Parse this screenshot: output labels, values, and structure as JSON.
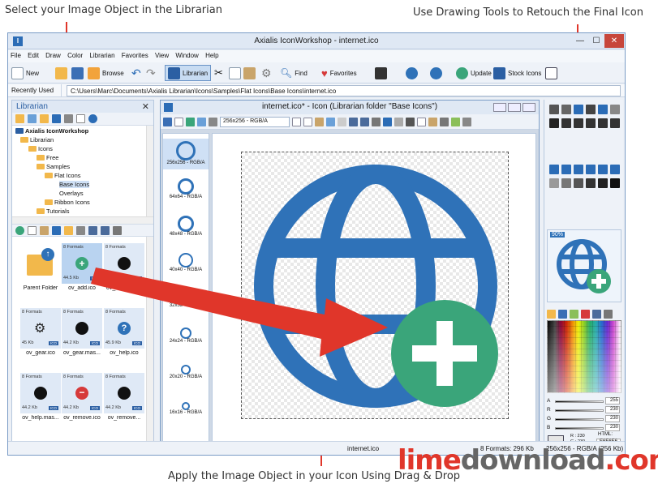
{
  "callouts": {
    "top_left": "Select your Image Object in the Librarian",
    "top_right": "Use Drawing Tools to Retouch the Final Icon",
    "bottom": "Apply the Image Object in your Icon Using Drag & Drop"
  },
  "window": {
    "title": "Axialis IconWorkshop - internet.ico",
    "minimize": "—",
    "maximize": "☐",
    "close": "✕"
  },
  "menu": [
    "File",
    "Edit",
    "Draw",
    "Color",
    "Librarian",
    "Favorites",
    "View",
    "Window",
    "Help"
  ],
  "toolbar": {
    "new": "New",
    "browse": "Browse",
    "librarian": "Librarian",
    "find": "Find",
    "favorites": "Favorites",
    "update": "Update",
    "stock_icons": "Stock Icons"
  },
  "pathbar": {
    "recent": "Recently Used",
    "path": "C:\\Users\\Marc\\Documents\\Axialis Librarian\\Icons\\Samples\\Flat Icons\\Base Icons\\internet.ico"
  },
  "librarian": {
    "title": "Librarian",
    "close": "✕",
    "tree": [
      {
        "label": "Axialis IconWorkshop",
        "bold": true
      },
      {
        "label": "Librarian"
      },
      {
        "label": "Icons"
      },
      {
        "label": "Free"
      },
      {
        "label": "Samples"
      },
      {
        "label": "Flat Icons"
      },
      {
        "label": "Base Icons"
      },
      {
        "label": "Overlays"
      },
      {
        "label": "Ribbon Icons"
      },
      {
        "label": "Tutorials"
      }
    ],
    "items": [
      {
        "name": "Parent Folder",
        "formats": "",
        "size": "",
        "badge": ""
      },
      {
        "name": "ov_add.ico",
        "formats": "8 Formats",
        "size": "44.5 Kb",
        "badge": "ICO"
      },
      {
        "name": "ov_add.mas...",
        "formats": "8 Formats",
        "size": "44.2 Kb",
        "badge": "ICO"
      },
      {
        "name": "ov_gear.ico",
        "formats": "8 Formats",
        "size": "45 Kb",
        "badge": "ICO"
      },
      {
        "name": "ov_gear.mas...",
        "formats": "8 Formats",
        "size": "44.2 Kb",
        "badge": "ICO"
      },
      {
        "name": "ov_help.ico",
        "formats": "8 Formats",
        "size": "45.9 Kb",
        "badge": "ICO"
      },
      {
        "name": "ov_help.mas...",
        "formats": "8 Formats",
        "size": "44.2 Kb",
        "badge": "ICO"
      },
      {
        "name": "ov_remove.ico",
        "formats": "8 Formats",
        "size": "44.2 Kb",
        "badge": "ICO"
      },
      {
        "name": "ov_remove...",
        "formats": "8 Formats",
        "size": "44.2 Kb",
        "badge": "ICO"
      }
    ]
  },
  "editor": {
    "title": "internet.ico* - Icon (Librarian folder \"Base Icons\")",
    "format_select": "256x256 - RGB/A",
    "formats": [
      "256x256 - RGB/A",
      "64x64 - RGB/A",
      "48x48 - RGB/A",
      "40x40 - RGB/A",
      "32x32 - RGB/A",
      "24x24 - RGB/A",
      "20x20 - RGB/A",
      "16x16 - RGB/A"
    ]
  },
  "status": {
    "file": "internet.ico",
    "formats": "8 Formats: 296 Kb",
    "current": "256x256 - RGB/A (256 Kb)"
  },
  "tools_panel": {
    "zoom": "90%",
    "sliders": [
      {
        "ch": "A",
        "val": "255"
      },
      {
        "ch": "R",
        "val": "230"
      },
      {
        "ch": "G",
        "val": "230"
      },
      {
        "ch": "B",
        "val": "230"
      }
    ],
    "rgb_readout": "R : 230\nG : 230\nB : 230\nA : 255",
    "html_label": "HTML:",
    "html_value": "E6E6E6"
  },
  "watermark": {
    "part1": "lime",
    "part2": "download",
    "part3": ".com"
  },
  "colors": {
    "globe": "#2f72b8",
    "add_badge": "#3aa57a",
    "arrow": "#e0362a"
  }
}
